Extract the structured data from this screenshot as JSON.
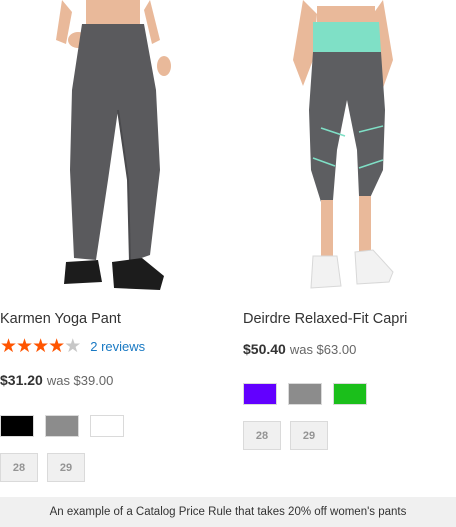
{
  "products": [
    {
      "name": "Karmen Yoga Pant",
      "rating": {
        "stars_filled": 4,
        "stars_total": 5,
        "reviews_label": "2 reviews"
      },
      "price": "$31.20",
      "was_price": "was $39.00",
      "colors": [
        "#000000",
        "#8c8c8c",
        "#ffffff"
      ],
      "sizes": [
        "28",
        "29"
      ]
    },
    {
      "name": "Deirdre Relaxed-Fit Capri",
      "price": "$50.40",
      "was_price": "was $63.00",
      "colors": [
        "#6200ff",
        "#8c8c8c",
        "#1bbf1b"
      ],
      "sizes": [
        "28",
        "29"
      ]
    }
  ],
  "colors": {
    "star_on": "#ff5501",
    "star_off": "#c7c7c7",
    "link": "#1979c3",
    "caption_bg": "#f0f0f0"
  },
  "caption": "An example of a Catalog Price Rule that takes 20% off women's pants"
}
